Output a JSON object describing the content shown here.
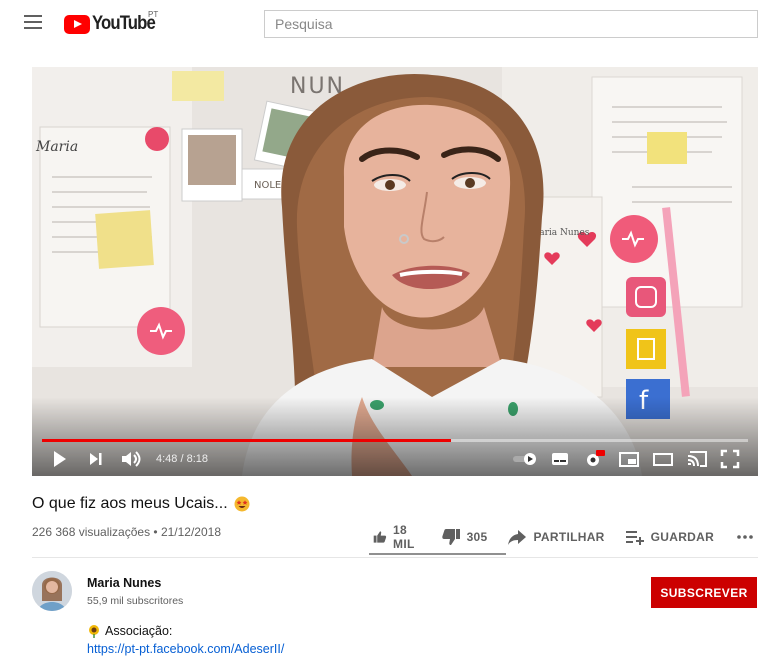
{
  "header": {
    "logo_text": "YouTube",
    "region": "PT",
    "search_placeholder": "Pesquisa"
  },
  "player": {
    "time": "4:48 / 8:18",
    "progress": 0.579,
    "overlay_text": "NUN",
    "scene_labels": {
      "left_note": "Maria",
      "photo_caption": "NOLE",
      "right_note": "Maria Nunes"
    }
  },
  "video": {
    "title": "O que fiz aos meus Ucais...",
    "title_emoji": "star-struck-emoji",
    "views_date": "226 368 visualizações • 21/12/2018",
    "likes": "18 MIL",
    "dislikes": "305",
    "share_label": "PARTILHAR",
    "save_label": "GUARDAR",
    "like_ratio": 0.983
  },
  "channel": {
    "name": "Maria Nunes",
    "subscribers": "55,9 mil subscritores",
    "subscribe_label": "SUBSCREVER"
  },
  "description": {
    "line1": "Associação:",
    "line1_icon": "sunflower-emoji",
    "link": "https://pt-pt.facebook.com/AdeserII/"
  },
  "colors": {
    "brand_red": "#ff0000",
    "subscribe_red": "#cc0000",
    "progress_red": "#ee0000",
    "link_blue": "#065fd4"
  }
}
